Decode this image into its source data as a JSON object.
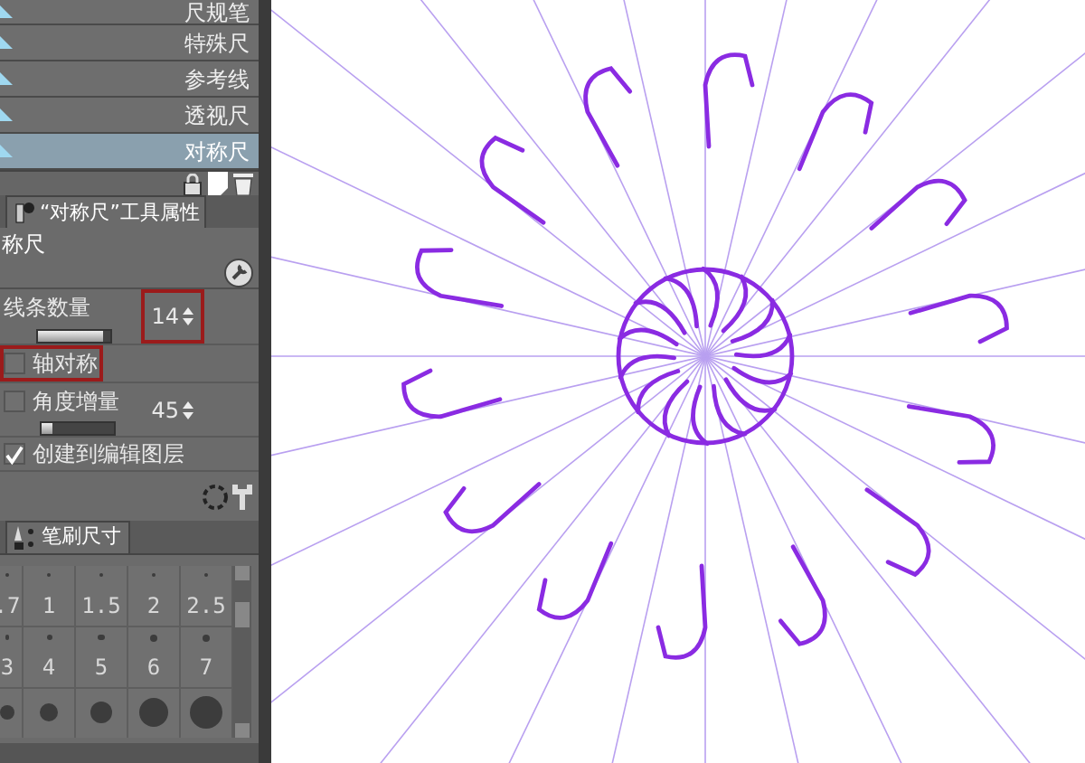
{
  "ruler_list": [
    {
      "label": "尺规笔",
      "selected": false
    },
    {
      "label": "特殊尺",
      "selected": false
    },
    {
      "label": "参考线",
      "selected": false
    },
    {
      "label": "透视尺",
      "selected": false
    },
    {
      "label": "对称尺",
      "selected": true
    }
  ],
  "tool_property_tab": {
    "label": "“对称尺”工具属性"
  },
  "tool_name": "称尺",
  "properties": {
    "line_count": {
      "label": "线条数量",
      "level": 0.9,
      "value": "14",
      "highlighted": true
    },
    "axis_symmetry": {
      "label": "轴对称",
      "checked": false,
      "highlighted": true
    },
    "angle_step": {
      "label": "角度增量",
      "checked": false,
      "level": 0.15,
      "value": "45"
    },
    "create_on_layer": {
      "label": "创建到编辑图层",
      "checked": true
    }
  },
  "brush_tab": {
    "label": "笔刷尺寸"
  },
  "brush_sizes": [
    {
      "label": ".7"
    },
    {
      "label": "1"
    },
    {
      "label": "1.5"
    },
    {
      "label": "2"
    },
    {
      "label": "2.5"
    },
    {
      "label": "3"
    },
    {
      "label": "4"
    },
    {
      "label": "5"
    },
    {
      "label": "6"
    },
    {
      "label": "7"
    }
  ]
}
